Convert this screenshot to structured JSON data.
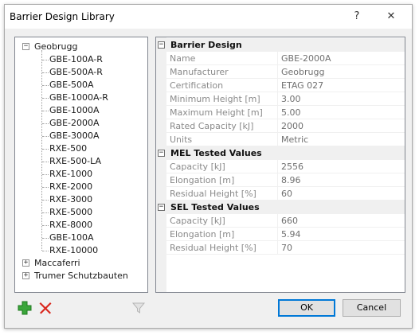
{
  "window": {
    "title": "Barrier Design Library",
    "help_glyph": "?",
    "close_glyph": "✕"
  },
  "tree": {
    "root": {
      "label": "Geobrugg",
      "expander": "−",
      "expanded": true
    },
    "children": [
      "GBE-100A-R",
      "GBE-500A-R",
      "GBE-500A",
      "GBE-1000A-R",
      "GBE-1000A",
      "GBE-2000A",
      "GBE-3000A",
      "RXE-500",
      "RXE-500-LA",
      "RXE-1000",
      "RXE-2000",
      "RXE-3000",
      "RXE-5000",
      "RXE-8000",
      "GBE-100A",
      "RXE-10000"
    ],
    "collapsed_roots": [
      {
        "label": "Maccaferri",
        "expander": "+"
      },
      {
        "label": "Trumer Schutzbauten",
        "expander": "+"
      }
    ]
  },
  "grid": {
    "categories": [
      {
        "label": "Barrier Design",
        "expander": "−",
        "rows": [
          {
            "name": "Name",
            "value": "GBE-2000A"
          },
          {
            "name": "Manufacturer",
            "value": "Geobrugg"
          },
          {
            "name": "Certification",
            "value": "ETAG 027"
          },
          {
            "name": "Minimum Height [m]",
            "value": "3.00"
          },
          {
            "name": "Maximum Height [m]",
            "value": "5.00"
          },
          {
            "name": "Rated Capacity [kJ]",
            "value": "2000"
          },
          {
            "name": "Units",
            "value": "Metric"
          }
        ]
      },
      {
        "label": "MEL Tested Values",
        "expander": "−",
        "rows": [
          {
            "name": "Capacity [kJ]",
            "value": "2556"
          },
          {
            "name": "Elongation [m]",
            "value": "8.96"
          },
          {
            "name": "Residual Height [%]",
            "value": "60"
          }
        ]
      },
      {
        "label": "SEL Tested Values",
        "expander": "−",
        "rows": [
          {
            "name": "Capacity [kJ]",
            "value": "660"
          },
          {
            "name": "Elongation [m]",
            "value": "5.94"
          },
          {
            "name": "Residual Height [%]",
            "value": "70"
          }
        ]
      }
    ]
  },
  "toolbar": {
    "add_icon": "plus-icon",
    "delete_icon": "delete-x-icon",
    "filter_icon": "filter-icon",
    "colors": {
      "add": "#3aa53a",
      "delete": "#d9261c",
      "filter_disabled": "#b5b5b5"
    }
  },
  "buttons": {
    "ok_label": "OK",
    "cancel_label": "Cancel"
  }
}
